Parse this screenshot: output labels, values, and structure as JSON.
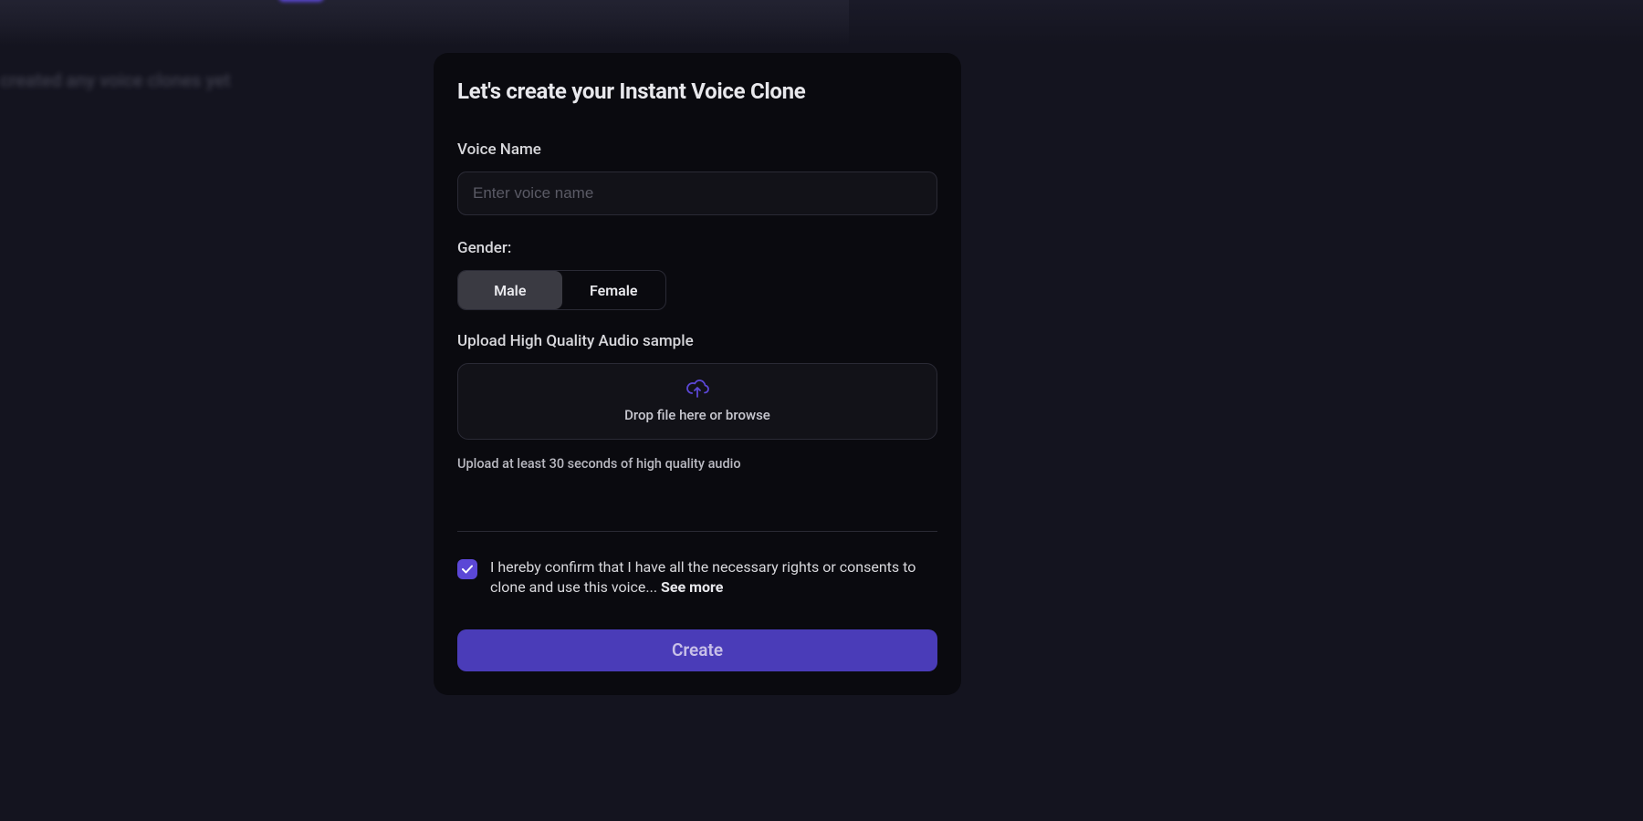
{
  "background": {
    "blurred_text": "created any voice clones yet"
  },
  "modal": {
    "title": "Let's create your Instant Voice Clone",
    "voice_name": {
      "label": "Voice Name",
      "placeholder": "Enter voice name",
      "value": ""
    },
    "gender": {
      "label": "Gender:",
      "options": {
        "male": "Male",
        "female": "Female"
      },
      "selected": "male"
    },
    "upload": {
      "label": "Upload High Quality Audio sample",
      "dropzone_text": "Drop file here or browse",
      "hint": "Upload at least 30 seconds of high quality audio"
    },
    "consent": {
      "checked": true,
      "text": "I hereby confirm that I have all the necessary rights or consents to clone and use this voice... ",
      "see_more": "See more"
    },
    "create_button": "Create"
  },
  "colors": {
    "accent": "#5b47d6",
    "modal_bg": "#0a0a0f",
    "page_bg": "#14141f"
  }
}
